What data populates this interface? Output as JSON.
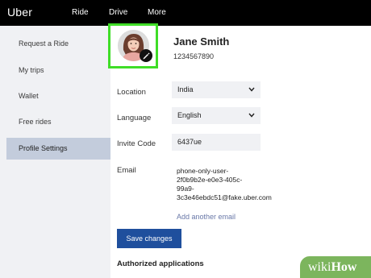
{
  "header": {
    "logo": "Uber",
    "nav": [
      "Ride",
      "Drive",
      "More"
    ]
  },
  "sidebar": {
    "items": [
      {
        "label": "Request a Ride"
      },
      {
        "label": "My trips"
      },
      {
        "label": "Wallet"
      },
      {
        "label": "Free rides"
      },
      {
        "label": "Profile Settings",
        "active": true
      }
    ]
  },
  "profile": {
    "name": "Jane Smith",
    "phone": "1234567890",
    "avatar_icon": "user-avatar-icon",
    "edit_icon": "pencil-icon"
  },
  "form": {
    "location_label": "Location",
    "location_value": "India",
    "language_label": "Language",
    "language_value": "English",
    "invite_label": "Invite Code",
    "invite_value": "6437ue",
    "email_label": "Email",
    "email_lines": [
      "phone-only-user-",
      "2f0b9b2e-e0e3-405c-",
      "99a9-",
      "3c3e46ebdc51@fake.uber.com"
    ],
    "add_email": "Add another email",
    "save_label": "Save changes",
    "authorized_label": "Authorized applications"
  },
  "watermark": {
    "wiki": "wiki",
    "how": "How"
  },
  "colors": {
    "topbar": "#000000",
    "sidebar_bg": "#f0f1f4",
    "active_item": "#c3ccdc",
    "highlight": "#3fdd27",
    "button": "#1f4f9d",
    "link": "#6978a8",
    "watermark": "#7cb55d"
  }
}
